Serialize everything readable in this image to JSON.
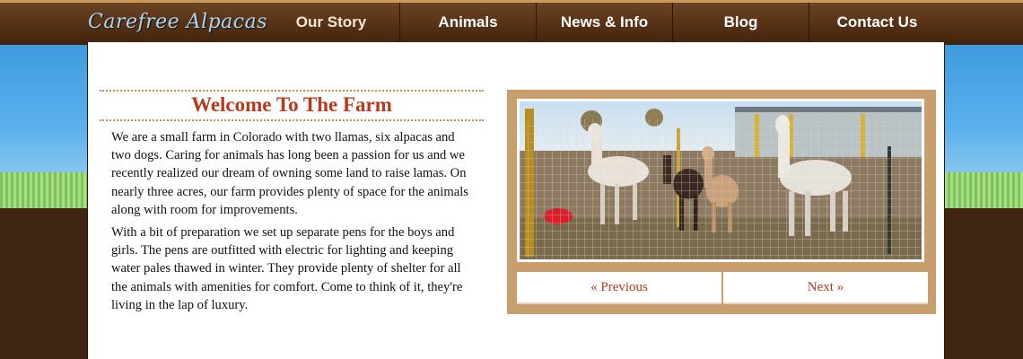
{
  "site": {
    "logo": "Carefree Alpacas"
  },
  "nav": {
    "items": [
      {
        "label": "Our Story",
        "active": true
      },
      {
        "label": "Animals"
      },
      {
        "label": "News & Info"
      },
      {
        "label": "Blog"
      },
      {
        "label": "Contact Us"
      }
    ]
  },
  "welcome": {
    "title": "Welcome To The Farm",
    "paragraphs": [
      "We are a small farm in Colorado with two llamas, six alpacas and two dogs. Caring for animals has long been a passion for us and we recently realized our dream of owning some land to raise lamas. On nearly three acres, our farm provides plenty of space for the animals along with room for improvements.",
      "With a bit of preparation we set up separate pens for the boys and girls. The pens are outfitted with electric for lighting and keeping water pales thawed in winter. They provide plenty of shelter for all the animals with amenities for comfort. Come to think of it, they're living in the lap of luxury."
    ]
  },
  "slider": {
    "prev_label": "« Previous",
    "next_label": "Next »"
  },
  "colors": {
    "accent_red": "#b8391c",
    "header_brown": "#5a3417",
    "slider_frame": "#c79e6c",
    "logo_blue": "#a9d8f5"
  }
}
